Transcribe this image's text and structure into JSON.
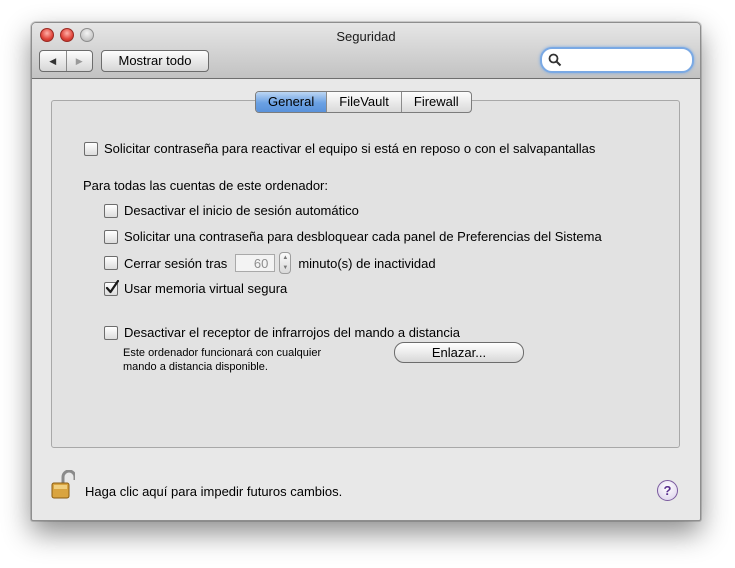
{
  "window": {
    "title": "Seguridad"
  },
  "toolbar": {
    "back_glyph": "◀",
    "forward_glyph": "▶",
    "show_all": "Mostrar todo",
    "search_value": ""
  },
  "tabs": [
    {
      "label": "General",
      "selected": true
    },
    {
      "label": "FileVault",
      "selected": false
    },
    {
      "label": "Firewall",
      "selected": false
    }
  ],
  "general": {
    "require_password": {
      "label": "Solicitar contraseña para reactivar el equipo si está en reposo o con el salvapantallas",
      "checked": false
    },
    "section_label": "Para todas las cuentas de este ordenador:",
    "disable_autologin": {
      "label": "Desactivar el inicio de sesión automático",
      "checked": false
    },
    "require_password_panes": {
      "label": "Solicitar una contraseña para desbloquear cada panel de Preferencias del Sistema",
      "checked": false
    },
    "logout": {
      "label_before": "Cerrar sesión tras",
      "minutes": "60",
      "label_after": "minuto(s) de inactividad",
      "checked": false
    },
    "secure_vm": {
      "label": "Usar memoria virtual segura",
      "checked": true
    },
    "disable_ir": {
      "label": "Desactivar el receptor de infrarrojos del mando a distancia",
      "checked": false
    },
    "ir_note_line1": "Este ordenador funcionará con cualquier",
    "ir_note_line2": "mando a distancia disponible.",
    "pair_button": "Enlazar..."
  },
  "footer": {
    "lock_message": "Haga clic aquí para impedir futuros cambios.",
    "help_glyph": "?"
  },
  "colors": {
    "accent": "#5a92db",
    "help": "#5a2f8e"
  }
}
